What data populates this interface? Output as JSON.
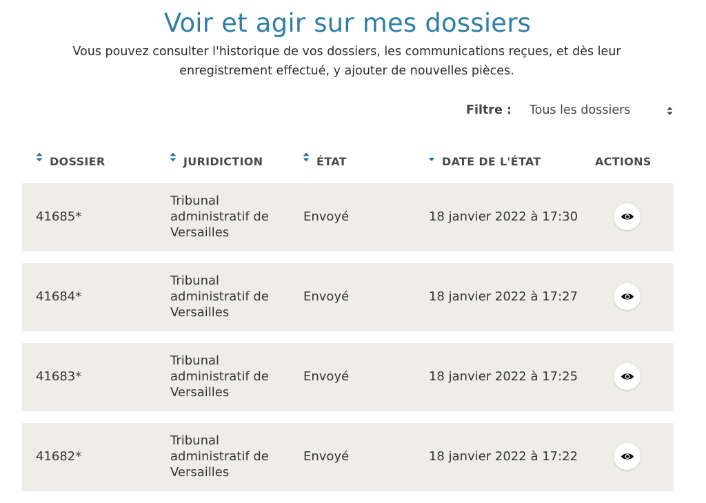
{
  "page": {
    "title": "Voir et agir sur mes dossiers",
    "subtitle": "Vous pouvez consulter l'historique de vos dossiers, les communications reçues, et dès leur enregistrement effectué, y ajouter de nouvelles pièces."
  },
  "filter": {
    "label": "Filtre :",
    "selected": "Tous les dossiers"
  },
  "table": {
    "columns": {
      "dossier": "DOSSIER",
      "juridiction": "JURIDICTION",
      "etat": "ÉTAT",
      "date": "DATE DE L'ÉTAT",
      "actions": "ACTIONS"
    },
    "rows": [
      {
        "dossier": "41685*",
        "juridiction": "Tribunal administratif de Versailles",
        "etat": "Envoyé",
        "date": "18 janvier 2022 à 17:30"
      },
      {
        "dossier": "41684*",
        "juridiction": "Tribunal administratif de Versailles",
        "etat": "Envoyé",
        "date": "18 janvier 2022 à 17:27"
      },
      {
        "dossier": "41683*",
        "juridiction": "Tribunal administratif de Versailles",
        "etat": "Envoyé",
        "date": "18 janvier 2022 à 17:25"
      },
      {
        "dossier": "41682*",
        "juridiction": "Tribunal administratif de Versailles",
        "etat": "Envoyé",
        "date": "18 janvier 2022 à 17:22"
      }
    ]
  },
  "icons": {
    "sort": "sort-both-icon",
    "sort_active": "sort-desc-icon",
    "view": "eye-icon"
  },
  "colors": {
    "title": "#2e7ea6",
    "sort_icon": "#2e6fa0",
    "row_bg": "#efede8"
  }
}
